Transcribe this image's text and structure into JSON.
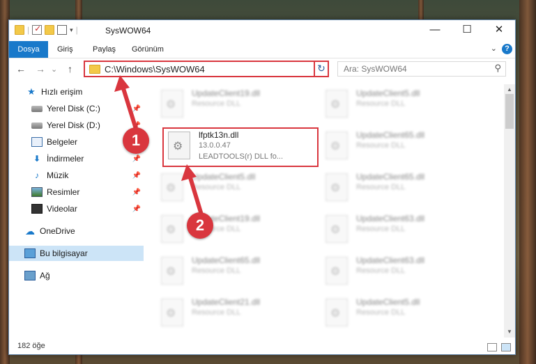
{
  "window": {
    "title": "SysWOW64"
  },
  "window_controls": {
    "minimize": "—",
    "maximize": "☐",
    "close": "✕"
  },
  "ribbon": {
    "tabs": [
      "Dosya",
      "Giriş",
      "Paylaş",
      "Görünüm"
    ],
    "help": "?",
    "collapse": "⌄"
  },
  "navigation": {
    "back": "←",
    "forward": "→",
    "recent": "⌄",
    "up": "↑",
    "address": "C:\\Windows\\SysWOW64",
    "dropdown": "⌄",
    "refresh": "↻",
    "search_placeholder": "Ara: SysWOW64",
    "search_icon": "⚲"
  },
  "sidebar": {
    "items": [
      {
        "label": "Hızlı erişim",
        "icon": "star-icon"
      },
      {
        "label": "Yerel Disk (C:)",
        "icon": "drive-icon",
        "pinned": true
      },
      {
        "label": "Yerel Disk (D:)",
        "icon": "drive-icon",
        "pinned": true
      },
      {
        "label": "Belgeler",
        "icon": "document-icon",
        "pinned": true
      },
      {
        "label": "İndirmeler",
        "icon": "download-icon",
        "pinned": true
      },
      {
        "label": "Müzik",
        "icon": "music-icon",
        "pinned": true
      },
      {
        "label": "Resimler",
        "icon": "pictures-icon",
        "pinned": true
      },
      {
        "label": "Videolar",
        "icon": "video-icon",
        "pinned": true
      },
      {
        "label": "OneDrive",
        "icon": "cloud-icon"
      },
      {
        "label": "Bu bilgisayar",
        "icon": "computer-icon",
        "selected": true
      },
      {
        "label": "Ağ",
        "icon": "network-icon"
      }
    ],
    "pin_glyph": "📌"
  },
  "files": {
    "highlighted": {
      "name": "lfptk13n.dll",
      "version": "13.0.0.47",
      "description": "LEADTOOLS(r) DLL fo..."
    },
    "left_column": [
      {
        "name": "UpdateClient19.dll",
        "type": "Resource DLL"
      },
      {
        "name": "UpdateClient5.dll",
        "type": "Resource DLL"
      },
      {
        "name": "UpdateClient19.dll",
        "type": "Resource DLL"
      },
      {
        "name": "UpdateClient65.dll",
        "type": "Resource DLL"
      },
      {
        "name": "UpdateClient21.dll",
        "type": "Resource DLL"
      }
    ],
    "right_column": [
      {
        "name": "UpdateClient5.dll",
        "type": "Resource DLL"
      },
      {
        "name": "UpdateClient65.dll",
        "type": "Resource DLL"
      },
      {
        "name": "UpdateClient65.dll",
        "type": "Resource DLL"
      },
      {
        "name": "UpdateClient63.dll",
        "type": "Resource DLL"
      },
      {
        "name": "UpdateClient63.dll",
        "type": "Resource DLL"
      },
      {
        "name": "UpdateClient5.dll",
        "type": "Resource DLL"
      }
    ]
  },
  "status": {
    "item_count": "182 öğe"
  },
  "annotations": {
    "step1": "1",
    "step2": "2",
    "color": "#d9363e"
  }
}
